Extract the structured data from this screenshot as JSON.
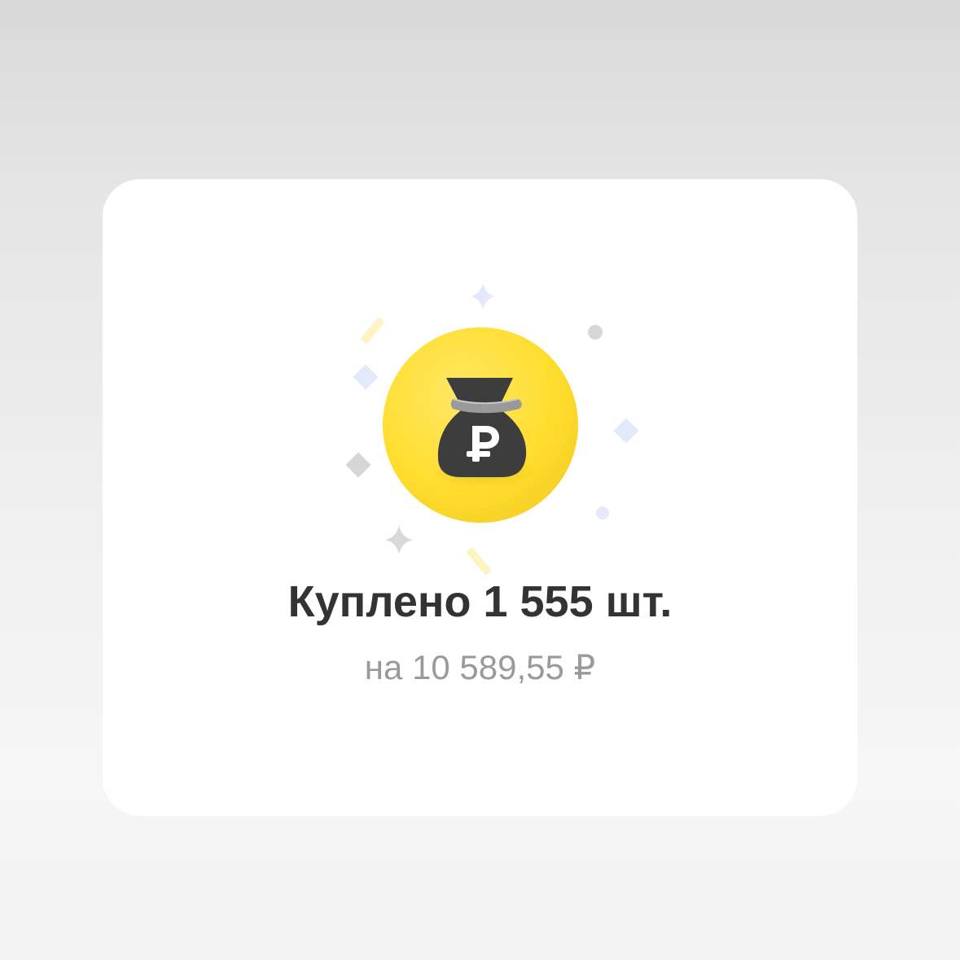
{
  "result": {
    "title": "Куплено 1 555 шт.",
    "subtitle": "на 10 589,55 ₽"
  },
  "icon": {
    "name": "money-bag-ruble-icon",
    "circle_color": "#ffdd2d",
    "bag_color": "#3d3d3d",
    "symbol": "₽"
  },
  "colors": {
    "title": "#333333",
    "subtitle": "#9a9a9a",
    "card": "#ffffff"
  }
}
